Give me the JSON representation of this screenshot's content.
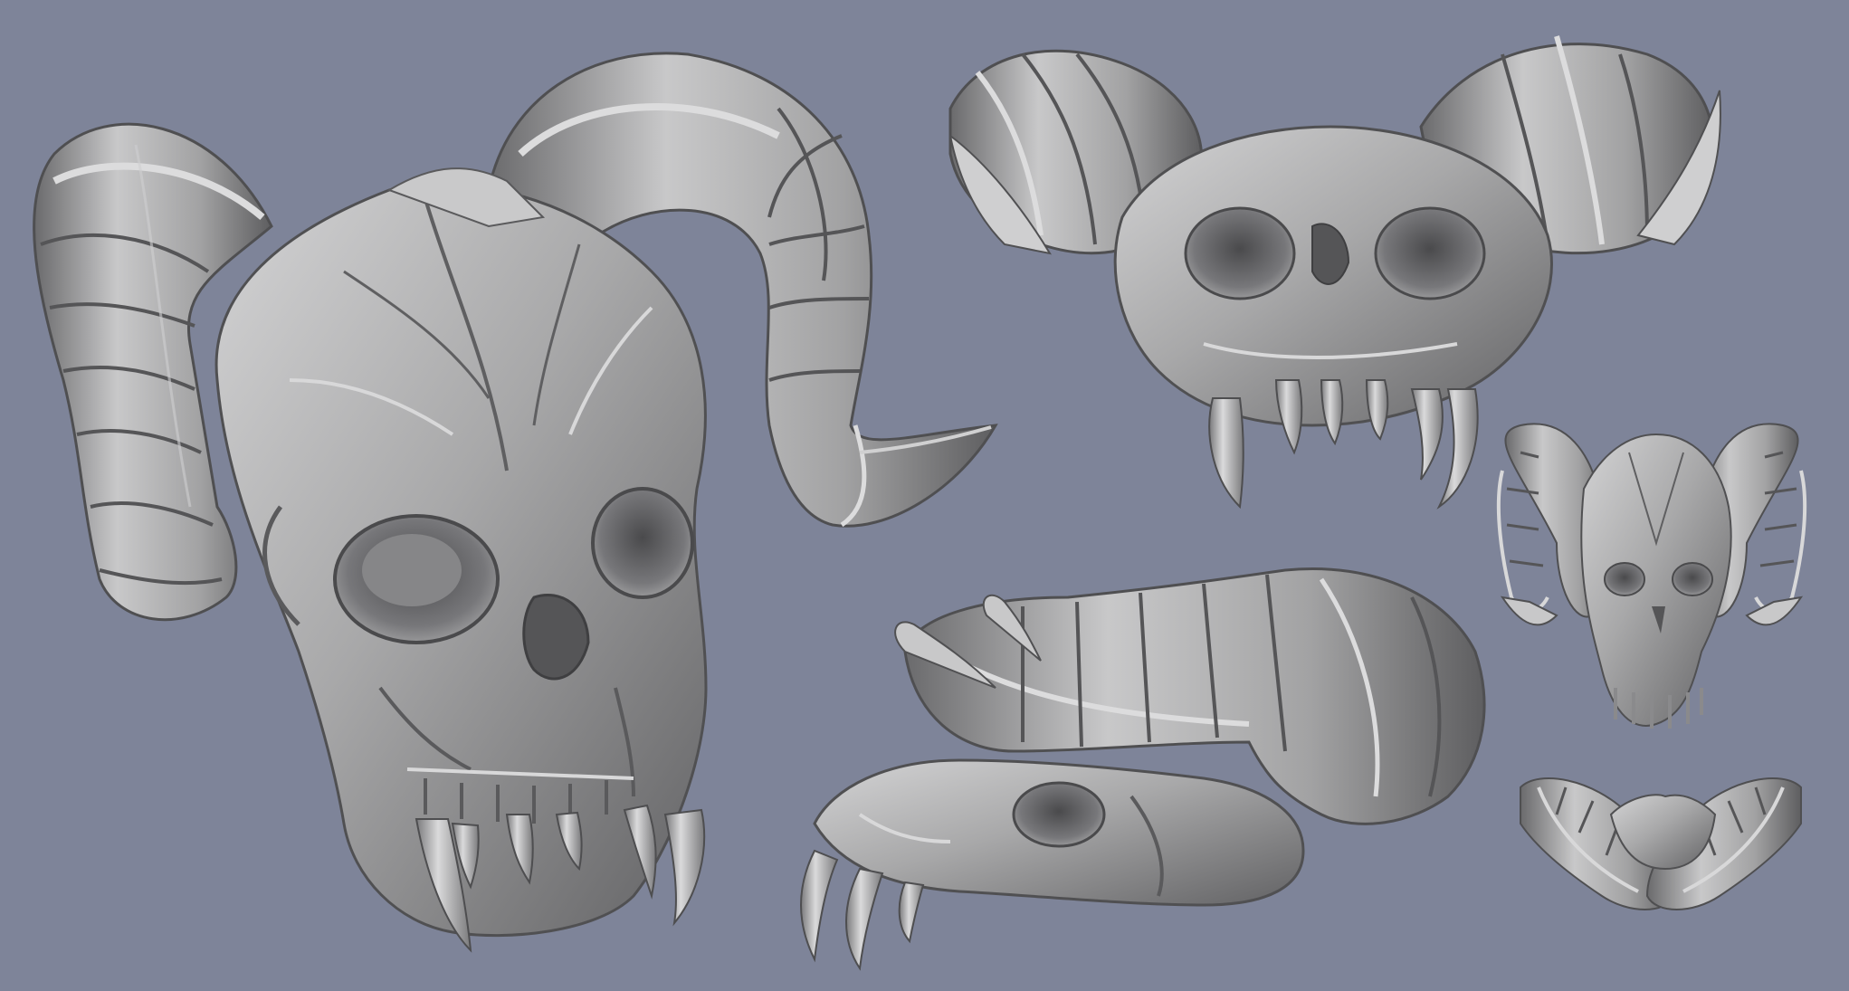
{
  "scene": {
    "background_color": "#7e8499",
    "material_color": "#a9a9aa",
    "material_shadow": "#5c5c5e",
    "material_highlight": "#d7d7d8",
    "subject": "demon-skull-sculpt",
    "views": [
      {
        "id": "three-quarter-large",
        "icon": "skull-three-quarter-view"
      },
      {
        "id": "underside",
        "icon": "skull-underside-view"
      },
      {
        "id": "side",
        "icon": "skull-side-view"
      },
      {
        "id": "front-small",
        "icon": "skull-front-view"
      },
      {
        "id": "top-small",
        "icon": "skull-top-view"
      }
    ]
  }
}
